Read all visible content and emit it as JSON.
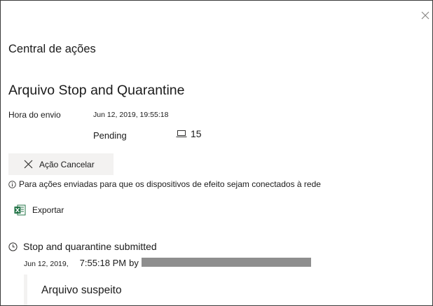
{
  "panel": {
    "title": "Central de ações",
    "close_icon": "close-icon"
  },
  "action": {
    "title": "Arquivo Stop and Quarantine",
    "submitted_label": "Hora do envio",
    "submitted_value": "Jun 12, 2019, 19:55:18",
    "status": "Pending",
    "device_icon": "laptop-icon",
    "device_count": "15"
  },
  "cancel_button": {
    "icon": "close-icon",
    "label": "Ação Cancelar"
  },
  "info": {
    "icon": "info-icon",
    "text": "Para ações enviadas para que os dispositivos de efeito sejam conectados à rede"
  },
  "export_button": {
    "icon": "excel-icon",
    "label": "Exportar"
  },
  "timeline": {
    "icon": "clock-icon",
    "title": "Stop and quarantine submitted",
    "date": "Jun 12, 2019,",
    "time": "7:55:18 PM",
    "by": "by"
  },
  "file_card": {
    "title": "Arquivo suspeito"
  }
}
